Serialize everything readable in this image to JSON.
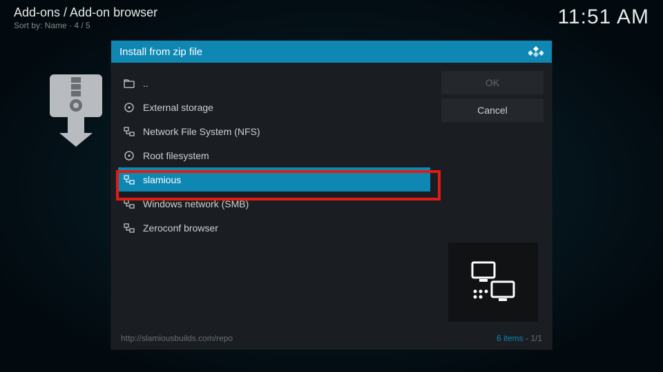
{
  "header": {
    "breadcrumb": "Add-ons / Add-on browser",
    "sort_info": "Sort by: Name  ·  4 / 5",
    "clock": "11:51 AM"
  },
  "dialog": {
    "title": "Install from zip file",
    "items": [
      {
        "icon": "folder-up",
        "label": ".."
      },
      {
        "icon": "disk",
        "label": "External storage"
      },
      {
        "icon": "network",
        "label": "Network File System (NFS)"
      },
      {
        "icon": "disk",
        "label": "Root filesystem"
      },
      {
        "icon": "network",
        "label": "slamious"
      },
      {
        "icon": "network",
        "label": "Windows network (SMB)"
      },
      {
        "icon": "network",
        "label": "Zeroconf browser"
      }
    ],
    "buttons": {
      "ok": "OK",
      "cancel": "Cancel"
    },
    "footer_path": "http://slamiousbuilds.com/repo",
    "footer_count": "6 items",
    "footer_page": "1/1"
  }
}
